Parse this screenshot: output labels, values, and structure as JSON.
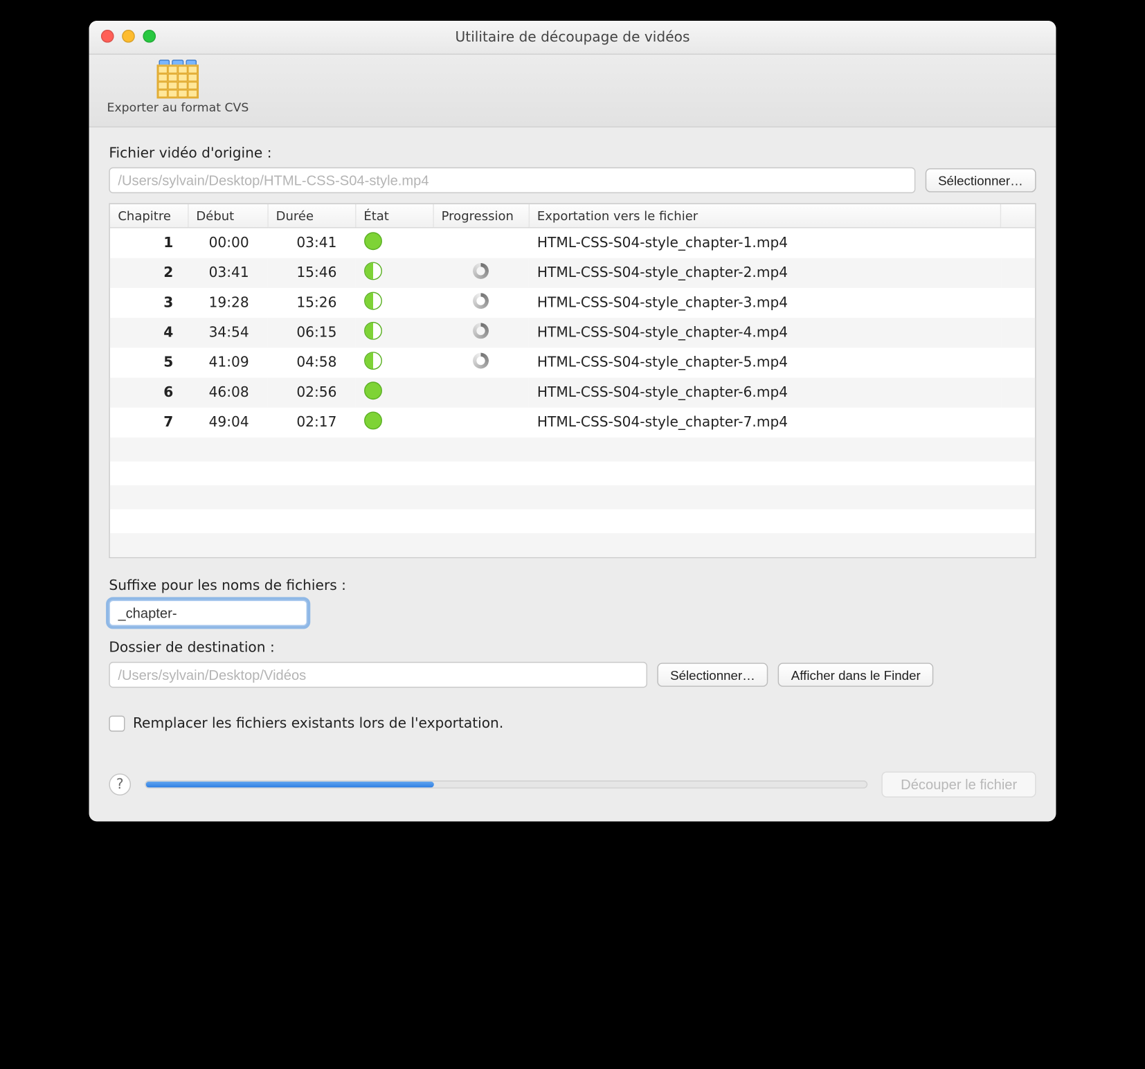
{
  "window": {
    "title": "Utilitaire de découpage de vidéos"
  },
  "toolbar": {
    "export_cvs_label": "Exporter au format CVS"
  },
  "source": {
    "label": "Fichier vidéo d'origine :",
    "path": "/Users/sylvain/Desktop/HTML-CSS-S04-style.mp4",
    "select_btn": "Sélectionner…"
  },
  "columns": {
    "chapter": "Chapitre",
    "start": "Début",
    "duration": "Durée",
    "state": "État",
    "progress": "Progression",
    "export_to": "Exportation vers le fichier"
  },
  "rows": [
    {
      "n": "1",
      "start": "00:00",
      "dur": "03:41",
      "state": "done",
      "spinner": false,
      "file": "HTML-CSS-S04-style_chapter-1.mp4"
    },
    {
      "n": "2",
      "start": "03:41",
      "dur": "15:46",
      "state": "pending",
      "spinner": true,
      "file": "HTML-CSS-S04-style_chapter-2.mp4"
    },
    {
      "n": "3",
      "start": "19:28",
      "dur": "15:26",
      "state": "pending",
      "spinner": true,
      "file": "HTML-CSS-S04-style_chapter-3.mp4"
    },
    {
      "n": "4",
      "start": "34:54",
      "dur": "06:15",
      "state": "pending",
      "spinner": true,
      "file": "HTML-CSS-S04-style_chapter-4.mp4"
    },
    {
      "n": "5",
      "start": "41:09",
      "dur": "04:58",
      "state": "pending",
      "spinner": true,
      "file": "HTML-CSS-S04-style_chapter-5.mp4"
    },
    {
      "n": "6",
      "start": "46:08",
      "dur": "02:56",
      "state": "done",
      "spinner": false,
      "file": "HTML-CSS-S04-style_chapter-6.mp4"
    },
    {
      "n": "7",
      "start": "49:04",
      "dur": "02:17",
      "state": "done",
      "spinner": false,
      "file": "HTML-CSS-S04-style_chapter-7.mp4"
    }
  ],
  "empty_rows": 5,
  "suffix": {
    "label": "Suffixe pour les noms de fichiers :",
    "value": "_chapter-"
  },
  "dest": {
    "label": "Dossier de destination :",
    "path": "/Users/sylvain/Desktop/Vidéos",
    "select_btn": "Sélectionner…",
    "reveal_btn": "Afficher dans le Finder"
  },
  "overwrite": {
    "label": "Remplacer les fichiers existants lors de l'exportation.",
    "checked": false
  },
  "footer": {
    "help": "?",
    "progress_percent": 40,
    "cut_btn": "Découper le fichier"
  }
}
